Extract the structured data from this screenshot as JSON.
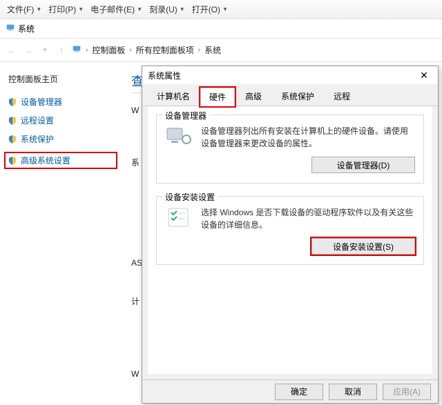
{
  "menubar": {
    "items": [
      {
        "label": "文件(F)"
      },
      {
        "label": "打印(P)"
      },
      {
        "label": "电子邮件(E)"
      },
      {
        "label": "刻录(U)"
      },
      {
        "label": "打开(O)"
      }
    ]
  },
  "address_row": {
    "system_label": "系统"
  },
  "breadcrumb": {
    "items": [
      "控制面板",
      "所有控制面板项",
      "系统"
    ]
  },
  "sidebar": {
    "title": "控制面板主页",
    "items": [
      {
        "label": "设备管理器"
      },
      {
        "label": "远程设置"
      },
      {
        "label": "系统保护"
      },
      {
        "label": "高级系统设置"
      }
    ]
  },
  "main": {
    "heading": "查",
    "rows": [
      "W",
      "系",
      "AS",
      "计",
      "W"
    ]
  },
  "dialog": {
    "title": "系统属性",
    "tabs": [
      {
        "label": "计算机名"
      },
      {
        "label": "硬件"
      },
      {
        "label": "高级"
      },
      {
        "label": "系统保护"
      },
      {
        "label": "远程"
      }
    ],
    "active_tab": 1,
    "groups": {
      "devmgr": {
        "title": "设备管理器",
        "text": "设备管理器列出所有安装在计算机上的硬件设备。请使用设备管理器来更改设备的属性。",
        "button": "设备管理器(D)"
      },
      "devinstall": {
        "title": "设备安装设置",
        "text": "选择 Windows 是否下载设备的驱动程序软件以及有关这些设备的详细信息。",
        "button": "设备安装设置(S)"
      }
    },
    "footer": {
      "ok": "确定",
      "cancel": "取消",
      "apply": "应用(A)"
    }
  }
}
